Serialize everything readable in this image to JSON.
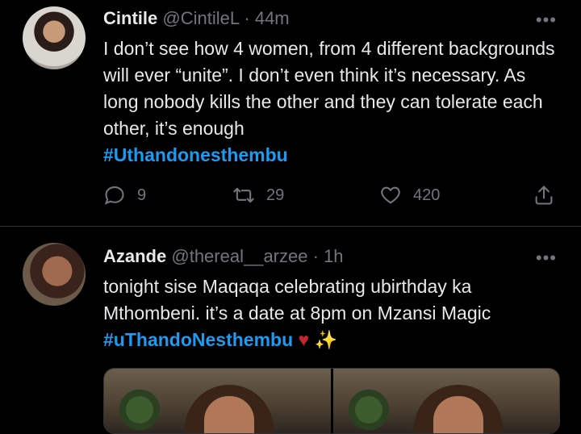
{
  "tweets": [
    {
      "name": "Cintile",
      "handle": "@CintileL",
      "separator": "·",
      "time": "44m",
      "more": "•••",
      "text": "I don’t see how 4 women, from 4 different backgrounds will ever “unite”. I don’t even think it’s necessary. As long nobody kills the other and they can tolerate each other, it’s enough",
      "hashtag": "#Uthandonesthembu",
      "replies": "9",
      "retweets": "29",
      "likes": "420"
    },
    {
      "name": "Azande",
      "handle": "@thereal__arzee",
      "separator": "·",
      "time": "1h",
      "more": "•••",
      "text": "tonight sise Maqaqa celebrating ubirthday ka Mthombeni. it’s a date at 8pm on Mzansi Magic",
      "hashtag": "#uThandoNesthembu",
      "emoji_heart": "♥",
      "emoji_sparkles": "✨"
    }
  ],
  "icons": {
    "reply": "reply-icon",
    "retweet": "retweet-icon",
    "like": "heart-icon",
    "share": "share-icon",
    "more": "more-icon"
  },
  "colors": {
    "background": "#000000",
    "text": "#e7e9ea",
    "muted": "#71767b",
    "link": "#1d9bf0",
    "divider": "#2f3336"
  }
}
